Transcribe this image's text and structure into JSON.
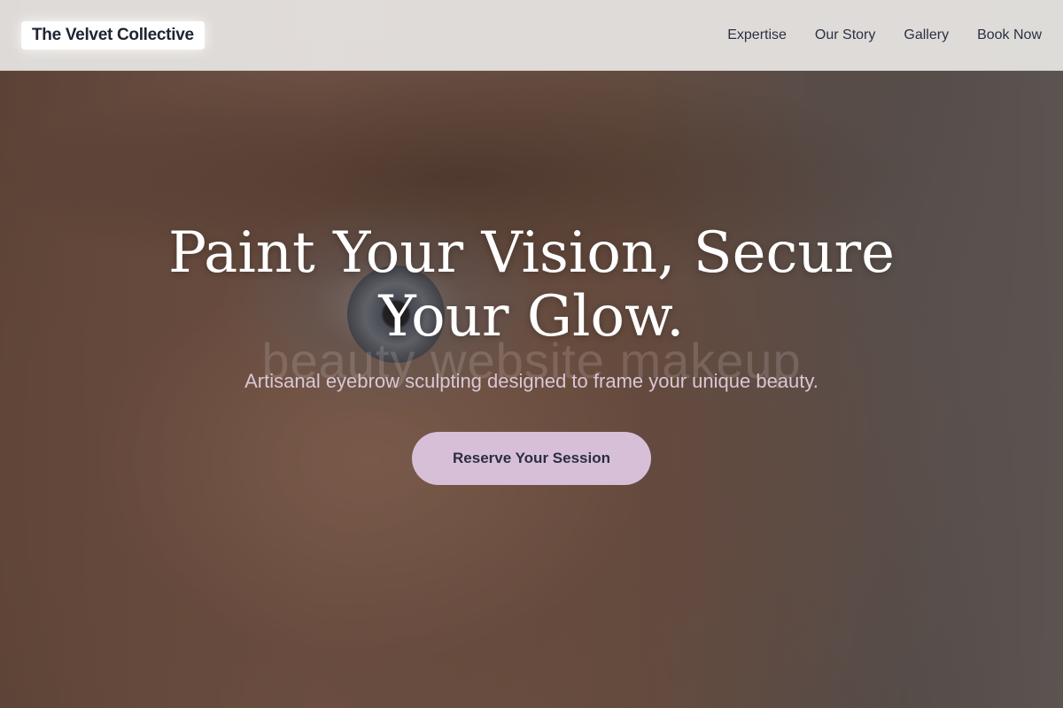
{
  "header": {
    "logo": "The Velvet Collective",
    "nav": [
      {
        "label": "Expertise"
      },
      {
        "label": "Our Story"
      },
      {
        "label": "Gallery"
      },
      {
        "label": "Book Now"
      }
    ]
  },
  "hero": {
    "title": "Paint Your Vision, Secure Your Glow.",
    "watermark": "beauty website makeup",
    "subtitle": "Artisanal eyebrow sculpting designed to frame your unique beauty.",
    "cta_label": "Reserve Your Session"
  },
  "colors": {
    "header_bg": "#e8e6e4",
    "cta_bg": "#d8bfd8",
    "cta_text": "#2b2d42",
    "subtitle": "#d9c7d6",
    "title": "#ffffff"
  }
}
